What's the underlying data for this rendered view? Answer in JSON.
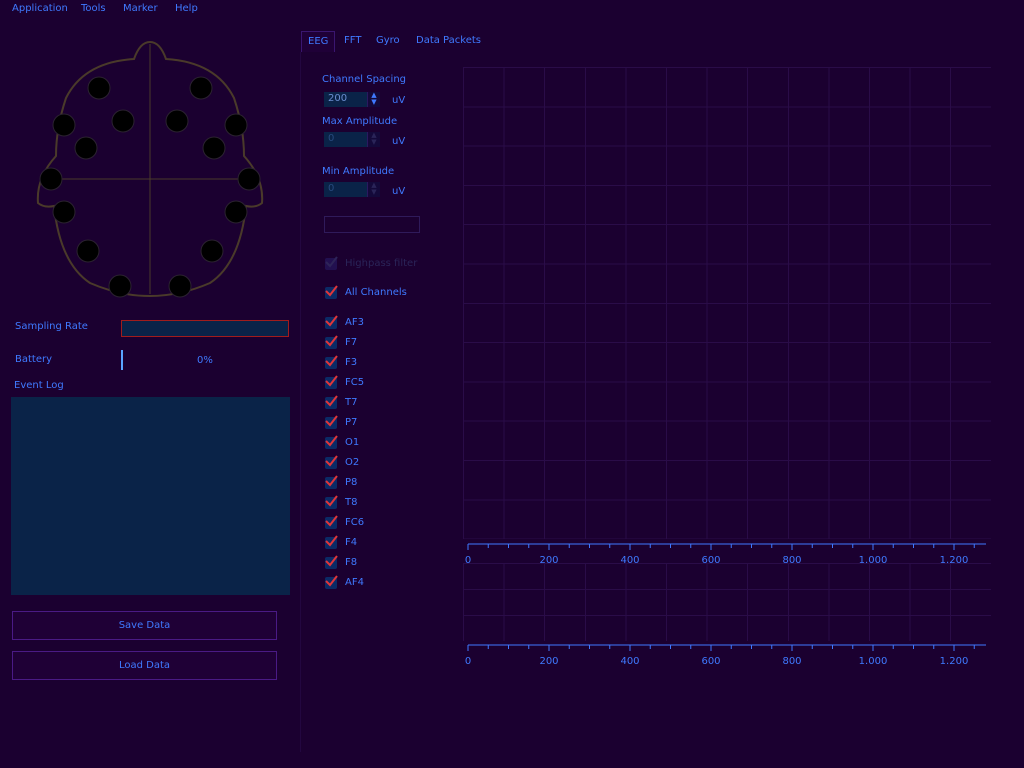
{
  "menu": [
    "Application",
    "Tools",
    "Marker",
    "Help"
  ],
  "left": {
    "sampling_rate_label": "Sampling Rate",
    "battery_label": "Battery",
    "battery_percent": "0%",
    "battery_level": 0,
    "event_log_label": "Event Log",
    "save_button": "Save Data",
    "load_button": "Load Data"
  },
  "tabs": [
    "EEG",
    "FFT",
    "Gyro",
    "Data Packets"
  ],
  "active_tab": "EEG",
  "controls": {
    "channel_spacing_label": "Channel Spacing",
    "channel_spacing_value": "200",
    "max_amplitude_label": "Max Amplitude",
    "max_amplitude_value": "0",
    "min_amplitude_label": "Min Amplitude",
    "min_amplitude_value": "0",
    "unit": "uV",
    "all_channels_label": "All Channels",
    "disabled_checkbox_label": "Highpass filter"
  },
  "channels": [
    "AF3",
    "F7",
    "F3",
    "FC5",
    "T7",
    "P7",
    "O1",
    "O2",
    "P8",
    "T8",
    "FC6",
    "F4",
    "F8",
    "AF4"
  ],
  "axes": {
    "ticks": [
      "0",
      "200",
      "400",
      "600",
      "800",
      "1.000",
      "1.200"
    ]
  },
  "colors": {
    "background": "#1b0030",
    "text": "#3f79ff",
    "check": "#e0363a",
    "panel": "#0a2348"
  }
}
